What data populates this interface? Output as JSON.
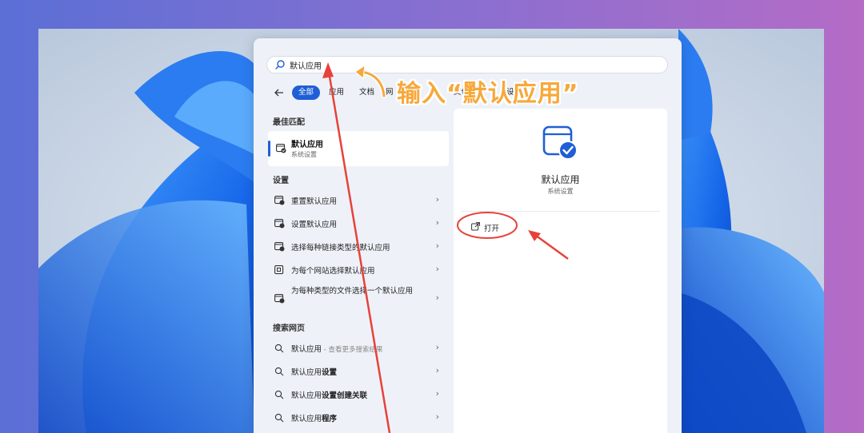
{
  "search": {
    "value": "默认应用"
  },
  "filters": [
    "全部",
    "应用",
    "文档",
    "网",
    "文件夹",
    "设"
  ],
  "best_match": {
    "heading": "最佳匹配",
    "title": "默认应用",
    "subtitle": "系统设置"
  },
  "settings": {
    "heading": "设置",
    "items": [
      "重置默认应用",
      "设置默认应用",
      "选择每种链接类型的默认应用",
      "为每个网站选择默认应用",
      "为每种类型的文件选择一个默认应用"
    ]
  },
  "web": {
    "heading": "搜索网页",
    "items": [
      {
        "main": "默认应用",
        "bold": "",
        "sub": " - 查看更多搜索结果"
      },
      {
        "main": "默认应用",
        "bold": "设置",
        "sub": ""
      },
      {
        "main": "默认应用",
        "bold": "设置创建关联",
        "sub": ""
      },
      {
        "main": "默认应用",
        "bold": "程序",
        "sub": ""
      }
    ]
  },
  "detail": {
    "title": "默认应用",
    "subtitle": "系统设置",
    "open_label": "打开"
  },
  "annotation": "输入“默认应用”",
  "colors": {
    "accent": "#1f5fd6",
    "annotation": "#f7a83a",
    "arrow": "#e8413a"
  }
}
